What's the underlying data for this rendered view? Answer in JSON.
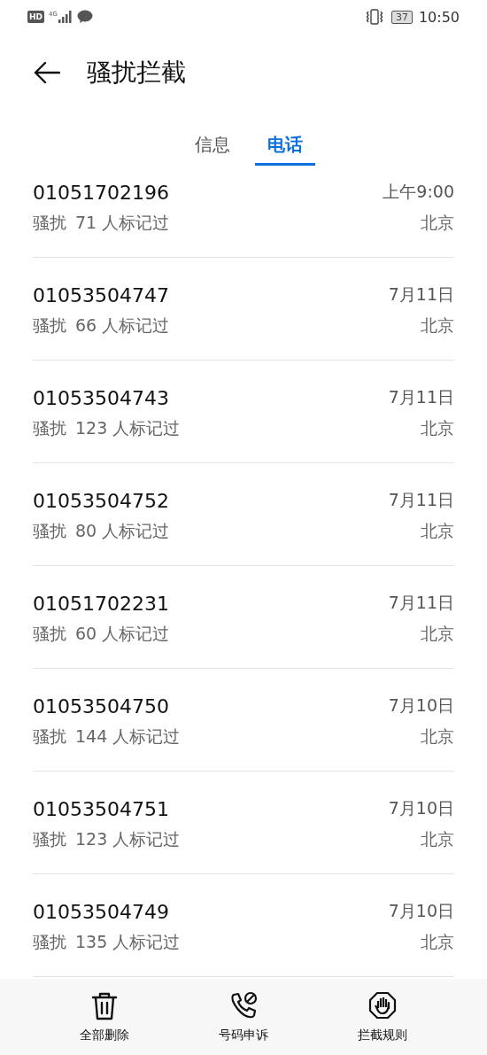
{
  "status_bar": {
    "hd": "HD",
    "network": "4G",
    "battery": "37",
    "time": "10:50"
  },
  "header": {
    "title": "骚扰拦截"
  },
  "tabs": [
    {
      "label": "信息",
      "selected": false
    },
    {
      "label": "电话",
      "selected": true
    }
  ],
  "calls": [
    {
      "number": "01051702196",
      "tag": "骚扰",
      "marks": "71 人标记过",
      "time": "上午9:00",
      "location": "北京"
    },
    {
      "number": "01053504747",
      "tag": "骚扰",
      "marks": "66 人标记过",
      "time": "7月11日",
      "location": "北京"
    },
    {
      "number": "01053504743",
      "tag": "骚扰",
      "marks": "123 人标记过",
      "time": "7月11日",
      "location": "北京"
    },
    {
      "number": "01053504752",
      "tag": "骚扰",
      "marks": "80 人标记过",
      "time": "7月11日",
      "location": "北京"
    },
    {
      "number": "01051702231",
      "tag": "骚扰",
      "marks": "60 人标记过",
      "time": "7月11日",
      "location": "北京"
    },
    {
      "number": "01053504750",
      "tag": "骚扰",
      "marks": "144 人标记过",
      "time": "7月10日",
      "location": "北京"
    },
    {
      "number": "01053504751",
      "tag": "骚扰",
      "marks": "123 人标记过",
      "time": "7月10日",
      "location": "北京"
    },
    {
      "number": "01053504749",
      "tag": "骚扰",
      "marks": "135 人标记过",
      "time": "7月10日",
      "location": "北京"
    }
  ],
  "bottom_bar": [
    {
      "kind": "trash",
      "label": "全部删除"
    },
    {
      "kind": "phone-block",
      "label": "号码申诉"
    },
    {
      "kind": "hand",
      "label": "拦截规则"
    }
  ]
}
